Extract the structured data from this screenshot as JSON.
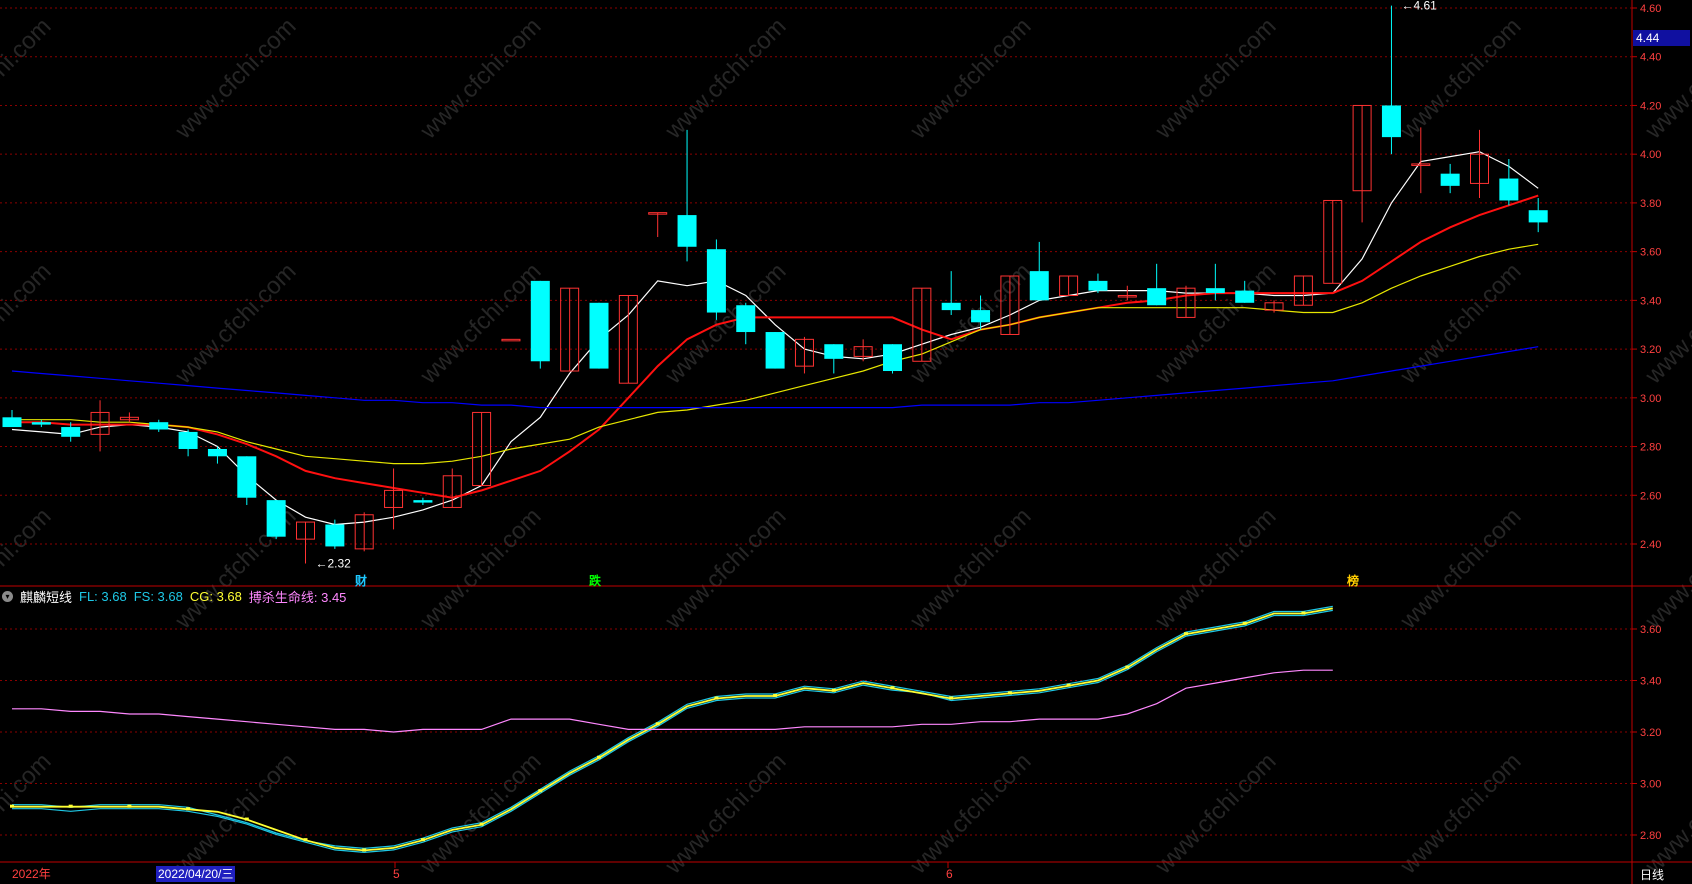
{
  "chart_data": [
    {
      "type": "candlestick",
      "ylim": [
        2.3,
        4.61
      ],
      "y_ticks": [
        "4.60",
        "4.40",
        "4.20",
        "4.00",
        "3.80",
        "3.60",
        "3.40",
        "3.20",
        "3.00",
        "2.80",
        "2.60",
        "2.40"
      ],
      "y_tick_values": [
        4.6,
        4.4,
        4.2,
        4.0,
        3.8,
        3.6,
        3.4,
        3.2,
        3.0,
        2.8,
        2.6,
        2.4
      ],
      "candles": [
        {
          "o": 2.92,
          "h": 2.95,
          "l": 2.88,
          "c": 2.88
        },
        {
          "o": 2.9,
          "h": 2.91,
          "l": 2.88,
          "c": 2.89
        },
        {
          "o": 2.88,
          "h": 2.9,
          "l": 2.82,
          "c": 2.84
        },
        {
          "o": 2.85,
          "h": 2.99,
          "l": 2.78,
          "c": 2.94
        },
        {
          "o": 2.91,
          "h": 2.94,
          "l": 2.9,
          "c": 2.92
        },
        {
          "o": 2.9,
          "h": 2.91,
          "l": 2.86,
          "c": 2.87
        },
        {
          "o": 2.86,
          "h": 2.87,
          "l": 2.76,
          "c": 2.79
        },
        {
          "o": 2.79,
          "h": 2.8,
          "l": 2.73,
          "c": 2.76
        },
        {
          "o": 2.76,
          "h": 2.76,
          "l": 2.56,
          "c": 2.59
        },
        {
          "o": 2.58,
          "h": 2.58,
          "l": 2.42,
          "c": 2.43
        },
        {
          "o": 2.42,
          "h": 2.49,
          "l": 2.32,
          "c": 2.49
        },
        {
          "o": 2.48,
          "h": 2.5,
          "l": 2.38,
          "c": 2.39
        },
        {
          "o": 2.38,
          "h": 2.53,
          "l": 2.37,
          "c": 2.52
        },
        {
          "o": 2.55,
          "h": 2.71,
          "l": 2.46,
          "c": 2.62
        },
        {
          "o": 2.58,
          "h": 2.59,
          "l": 2.56,
          "c": 2.57
        },
        {
          "o": 2.55,
          "h": 2.71,
          "l": 2.55,
          "c": 2.68
        },
        {
          "o": 2.64,
          "h": 2.94,
          "l": 2.64,
          "c": 2.94
        },
        {
          "o": 3.24,
          "h": 3.24,
          "l": 3.24,
          "c": 3.24
        },
        {
          "o": 3.48,
          "h": 3.48,
          "l": 3.12,
          "c": 3.15
        },
        {
          "o": 3.11,
          "h": 3.45,
          "l": 3.11,
          "c": 3.45
        },
        {
          "o": 3.39,
          "h": 3.39,
          "l": 3.12,
          "c": 3.12
        },
        {
          "o": 3.06,
          "h": 3.42,
          "l": 3.06,
          "c": 3.42
        },
        {
          "o": 3.76,
          "h": 3.76,
          "l": 3.66,
          "c": 3.76
        },
        {
          "o": 3.75,
          "h": 4.1,
          "l": 3.56,
          "c": 3.62
        },
        {
          "o": 3.61,
          "h": 3.65,
          "l": 3.32,
          "c": 3.35
        },
        {
          "o": 3.38,
          "h": 3.39,
          "l": 3.22,
          "c": 3.27
        },
        {
          "o": 3.27,
          "h": 3.27,
          "l": 3.12,
          "c": 3.12
        },
        {
          "o": 3.13,
          "h": 3.25,
          "l": 3.1,
          "c": 3.24
        },
        {
          "o": 3.22,
          "h": 3.22,
          "l": 3.1,
          "c": 3.16
        },
        {
          "o": 3.17,
          "h": 3.24,
          "l": 3.15,
          "c": 3.21
        },
        {
          "o": 3.22,
          "h": 3.22,
          "l": 3.1,
          "c": 3.11
        },
        {
          "o": 3.15,
          "h": 3.45,
          "l": 3.15,
          "c": 3.45
        },
        {
          "o": 3.39,
          "h": 3.52,
          "l": 3.34,
          "c": 3.36
        },
        {
          "o": 3.36,
          "h": 3.42,
          "l": 3.28,
          "c": 3.31
        },
        {
          "o": 3.26,
          "h": 3.5,
          "l": 3.26,
          "c": 3.5
        },
        {
          "o": 3.52,
          "h": 3.64,
          "l": 3.45,
          "c": 3.4
        },
        {
          "o": 3.42,
          "h": 3.5,
          "l": 3.42,
          "c": 3.5
        },
        {
          "o": 3.48,
          "h": 3.51,
          "l": 3.43,
          "c": 3.44
        },
        {
          "o": 3.42,
          "h": 3.46,
          "l": 3.4,
          "c": 3.42
        },
        {
          "o": 3.45,
          "h": 3.55,
          "l": 3.38,
          "c": 3.38
        },
        {
          "o": 3.33,
          "h": 3.46,
          "l": 3.33,
          "c": 3.45
        },
        {
          "o": 3.45,
          "h": 3.55,
          "l": 3.4,
          "c": 3.43
        },
        {
          "o": 3.44,
          "h": 3.48,
          "l": 3.39,
          "c": 3.39
        },
        {
          "o": 3.36,
          "h": 3.4,
          "l": 3.35,
          "c": 3.39
        },
        {
          "o": 3.38,
          "h": 3.5,
          "l": 3.38,
          "c": 3.5
        },
        {
          "o": 3.47,
          "h": 3.81,
          "l": 3.47,
          "c": 3.81
        },
        {
          "o": 3.85,
          "h": 4.2,
          "l": 3.72,
          "c": 4.2
        },
        {
          "o": 4.2,
          "h": 4.61,
          "l": 4.0,
          "c": 4.07
        },
        {
          "o": 3.96,
          "h": 4.11,
          "l": 3.84,
          "c": 3.96
        },
        {
          "o": 3.92,
          "h": 3.96,
          "l": 3.84,
          "c": 3.87
        },
        {
          "o": 3.88,
          "h": 4.1,
          "l": 3.82,
          "c": 4.0
        },
        {
          "o": 3.9,
          "h": 3.98,
          "l": 3.79,
          "c": 3.81
        },
        {
          "o": 3.77,
          "h": 3.82,
          "l": 3.68,
          "c": 3.72
        }
      ],
      "series": [
        {
          "color": "#ffffff",
          "values": [
            2.87,
            2.86,
            2.85,
            2.88,
            2.89,
            2.88,
            2.86,
            2.8,
            2.68,
            2.58,
            2.51,
            2.48,
            2.49,
            2.51,
            2.54,
            2.58,
            2.64,
            2.82,
            2.92,
            3.1,
            3.24,
            3.34,
            3.48,
            3.46,
            3.48,
            3.42,
            3.3,
            3.2,
            3.17,
            3.16,
            3.18,
            3.22,
            3.26,
            3.29,
            3.34,
            3.4,
            3.42,
            3.44,
            3.44,
            3.44,
            3.43,
            3.43,
            3.43,
            3.42,
            3.42,
            3.43,
            3.57,
            3.8,
            3.97,
            3.99,
            4.01,
            3.95,
            3.86
          ]
        },
        {
          "color": "#ff1010",
          "values": [
            2.9,
            2.9,
            2.89,
            2.89,
            2.89,
            2.89,
            2.88,
            2.85,
            2.81,
            2.76,
            2.7,
            2.67,
            2.65,
            2.63,
            2.61,
            2.59,
            2.62,
            2.66,
            2.7,
            2.78,
            2.87,
            3.0,
            3.13,
            3.24,
            3.3,
            3.33,
            3.33,
            3.33,
            3.33,
            3.33,
            3.33,
            3.28,
            3.24,
            3.28,
            3.3,
            3.33,
            3.35,
            3.37,
            3.39,
            3.4,
            3.42,
            3.43,
            3.43,
            3.43,
            3.43,
            3.43,
            3.48,
            3.56,
            3.64,
            3.7,
            3.75,
            3.79,
            3.83
          ]
        },
        {
          "color": "#e6e600",
          "values": [
            2.91,
            2.91,
            2.91,
            2.9,
            2.9,
            2.89,
            2.88,
            2.86,
            2.82,
            2.79,
            2.76,
            2.75,
            2.74,
            2.73,
            2.73,
            2.74,
            2.76,
            2.79,
            2.81,
            2.83,
            2.88,
            2.91,
            2.94,
            2.95,
            2.97,
            2.99,
            3.02,
            3.05,
            3.08,
            3.11,
            3.15,
            3.18,
            3.23,
            3.28,
            3.3,
            3.33,
            3.35,
            3.37,
            3.37,
            3.37,
            3.37,
            3.37,
            3.37,
            3.36,
            3.35,
            3.35,
            3.39,
            3.45,
            3.5,
            3.54,
            3.58,
            3.61,
            3.63
          ]
        },
        {
          "color": "#0000ff",
          "values": [
            3.11,
            3.1,
            3.09,
            3.08,
            3.07,
            3.06,
            3.05,
            3.04,
            3.03,
            3.02,
            3.01,
            3.0,
            2.99,
            2.99,
            2.98,
            2.98,
            2.97,
            2.97,
            2.96,
            2.96,
            2.96,
            2.96,
            2.96,
            2.96,
            2.96,
            2.96,
            2.96,
            2.96,
            2.96,
            2.96,
            2.96,
            2.97,
            2.97,
            2.97,
            2.97,
            2.98,
            2.98,
            2.99,
            3.0,
            3.01,
            3.02,
            3.03,
            3.04,
            3.05,
            3.06,
            3.07,
            3.09,
            3.11,
            3.13,
            3.15,
            3.17,
            3.19,
            3.21
          ]
        }
      ],
      "annotations": [
        {
          "text": "4.61",
          "candle": 47,
          "y": 4.61
        },
        {
          "text": "2.32",
          "candle": 10,
          "y": 2.32
        }
      ]
    },
    {
      "type": "line",
      "ylim": [
        2.73,
        3.77
      ],
      "y_ticks": [
        "3.60",
        "3.40",
        "3.20",
        "3.00",
        "2.80"
      ],
      "y_tick_values": [
        3.6,
        3.4,
        3.2,
        3.0,
        2.8
      ],
      "series": [
        {
          "name": "FL",
          "color": "#1ec8e6",
          "values": [
            2.91,
            2.91,
            2.9,
            2.91,
            2.91,
            2.91,
            2.9,
            2.88,
            2.85,
            2.81,
            2.78,
            2.75,
            2.74,
            2.75,
            2.78,
            2.82,
            2.84,
            2.9,
            2.97,
            3.04,
            3.1,
            3.17,
            3.23,
            3.3,
            3.33,
            3.34,
            3.34,
            3.37,
            3.36,
            3.39,
            3.37,
            3.36,
            3.33,
            3.34,
            3.35,
            3.36,
            3.38,
            3.4,
            3.45,
            3.52,
            3.58,
            3.6,
            3.62,
            3.66,
            3.66,
            3.68
          ]
        },
        {
          "name": "FS",
          "color": "#1ec8e6",
          "values": [
            2.91,
            2.91,
            2.9,
            2.91,
            2.91,
            2.91,
            2.9,
            2.87,
            2.84,
            2.8,
            2.77,
            2.75,
            2.74,
            2.75,
            2.78,
            2.82,
            2.84,
            2.9,
            2.97,
            3.04,
            3.1,
            3.17,
            3.23,
            3.3,
            3.33,
            3.34,
            3.34,
            3.37,
            3.36,
            3.39,
            3.37,
            3.35,
            3.33,
            3.34,
            3.35,
            3.36,
            3.38,
            3.4,
            3.45,
            3.52,
            3.58,
            3.6,
            3.62,
            3.66,
            3.66,
            3.68
          ]
        },
        {
          "name": "CG",
          "color": "#ffff33",
          "values": [
            2.91,
            2.91,
            2.91,
            2.91,
            2.91,
            2.91,
            2.9,
            2.89,
            2.86,
            2.82,
            2.78,
            2.75,
            2.74,
            2.75,
            2.78,
            2.82,
            2.84,
            2.9,
            2.97,
            3.04,
            3.1,
            3.17,
            3.23,
            3.3,
            3.33,
            3.34,
            3.34,
            3.37,
            3.36,
            3.39,
            3.37,
            3.35,
            3.33,
            3.34,
            3.35,
            3.36,
            3.38,
            3.4,
            3.45,
            3.52,
            3.58,
            3.6,
            3.62,
            3.66,
            3.66,
            3.68
          ]
        },
        {
          "name": "搏杀生命线",
          "color": "#ff88ff",
          "values": [
            3.29,
            3.29,
            3.28,
            3.28,
            3.27,
            3.27,
            3.26,
            3.25,
            3.24,
            3.23,
            3.22,
            3.21,
            3.21,
            3.2,
            3.21,
            3.21,
            3.21,
            3.25,
            3.25,
            3.25,
            3.23,
            3.21,
            3.21,
            3.21,
            3.21,
            3.21,
            3.21,
            3.22,
            3.22,
            3.22,
            3.22,
            3.23,
            3.23,
            3.24,
            3.24,
            3.25,
            3.25,
            3.25,
            3.27,
            3.31,
            3.37,
            3.39,
            3.41,
            3.43,
            3.44,
            3.44
          ]
        }
      ]
    }
  ],
  "indicator": {
    "name": "麒麟短线",
    "fl": "FL: 3.68",
    "fs": "FS: 3.68",
    "cg": "CG: 3.68",
    "life": "搏杀生命线: 3.45"
  },
  "current_price": "4.44",
  "event_tags": [
    "财",
    "跌",
    "榜"
  ],
  "x_axis": {
    "year": "2022年",
    "cursor_date": "2022/04/20/三",
    "month5": "5",
    "month6": "6",
    "period": "日线"
  },
  "watermark": "www.cfchi.com",
  "colors": {
    "up": "#ff3232",
    "down": "#00ffff",
    "grid": "#8b0000",
    "axis": "#c00000",
    "text": "#ffffff"
  }
}
